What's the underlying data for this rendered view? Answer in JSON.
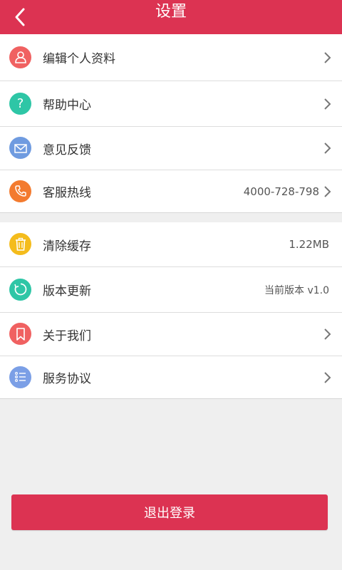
{
  "header": {
    "title": "设置",
    "back_icon": "chevron-left-icon",
    "background": "#dc3352"
  },
  "group1": [
    {
      "label": "编辑个人资料",
      "icon": "user-icon",
      "color": "#f06161",
      "value": "",
      "arrow": true
    },
    {
      "label": "帮助中心",
      "icon": "question-icon",
      "color": "#2ec6a6",
      "value": "",
      "arrow": true
    },
    {
      "label": "意见反馈",
      "icon": "mail-icon",
      "color": "#6f9be0",
      "value": "",
      "arrow": true
    },
    {
      "label": "客服热线",
      "icon": "phone-icon",
      "color": "#f37b2f",
      "value": "4000-728-798",
      "arrow": true
    }
  ],
  "group2": [
    {
      "label": "清除缓存",
      "icon": "trash-icon",
      "color": "#f4bc1c",
      "value": "1.22MB",
      "arrow": false
    },
    {
      "label": "版本更新",
      "icon": "refresh-icon",
      "color": "#2ec6a6",
      "value": "当前版本 v1.0",
      "arrow": false
    },
    {
      "label": "关于我们",
      "icon": "bookmark-icon",
      "color": "#f06161",
      "value": "",
      "arrow": true
    },
    {
      "label": "服务协议",
      "icon": "list-icon",
      "color": "#7b9fe6",
      "value": "",
      "arrow": true
    }
  ],
  "logout": {
    "label": "退出登录",
    "color": "#dc3352"
  }
}
